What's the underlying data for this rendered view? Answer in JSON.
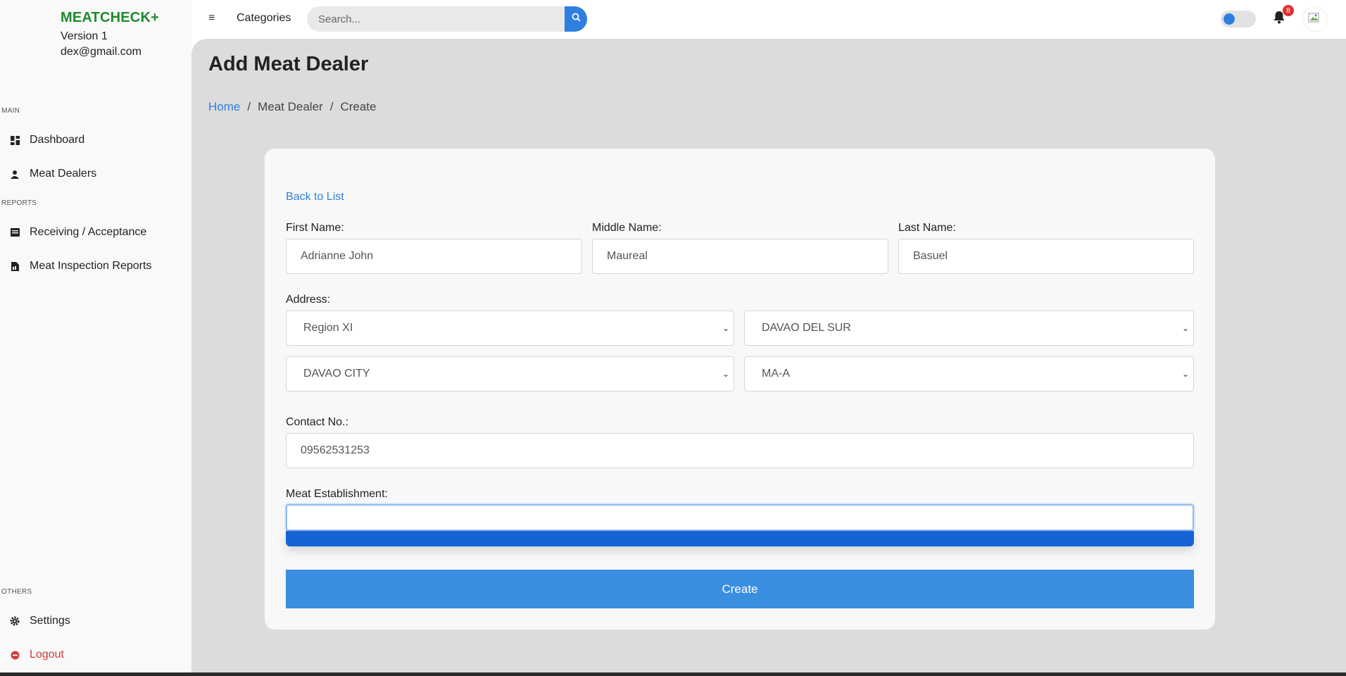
{
  "brand": {
    "title": "MEATCHECK+",
    "version": "Version 1",
    "email": "dex@gmail.com"
  },
  "sidebar": {
    "sections": {
      "main": "MAIN",
      "reports": "REPORTS",
      "others": "OTHERS"
    },
    "items": [
      {
        "label": "Dashboard",
        "icon": "dashboard-icon"
      },
      {
        "label": "Meat Dealers",
        "icon": "user-icon"
      },
      {
        "label": "Receiving / Acceptance",
        "icon": "list-icon"
      },
      {
        "label": "Meat Inspection Reports",
        "icon": "document-icon"
      },
      {
        "label": "Settings",
        "icon": "gear-icon"
      },
      {
        "label": "Logout",
        "icon": "logout-icon"
      }
    ]
  },
  "topbar": {
    "categories": "Categories",
    "search_placeholder": "Search...",
    "notification_count": "8"
  },
  "page": {
    "title": "Add Meat Dealer",
    "breadcrumb": [
      "Home",
      "Meat Dealer",
      "Create"
    ],
    "back_link": "Back to List"
  },
  "form": {
    "first_name": {
      "label": "First Name:",
      "value": "Adrianne John"
    },
    "middle_name": {
      "label": "Middle Name:",
      "value": "Maureal"
    },
    "last_name": {
      "label": "Last Name:",
      "value": "Basuel"
    },
    "address_label": "Address:",
    "region": "Region XI",
    "province": "DAVAO DEL SUR",
    "city": "DAVAO CITY",
    "barangay": "MA-A",
    "contact": {
      "label": "Contact No.:",
      "value": "09562531253"
    },
    "establishment": {
      "label": "Meat Establishment:",
      "value": ""
    },
    "submit_label": "Create"
  },
  "colors": {
    "brand": "#1e8a2e",
    "accent": "#2f7fe0",
    "logout": "#d23b3b"
  }
}
